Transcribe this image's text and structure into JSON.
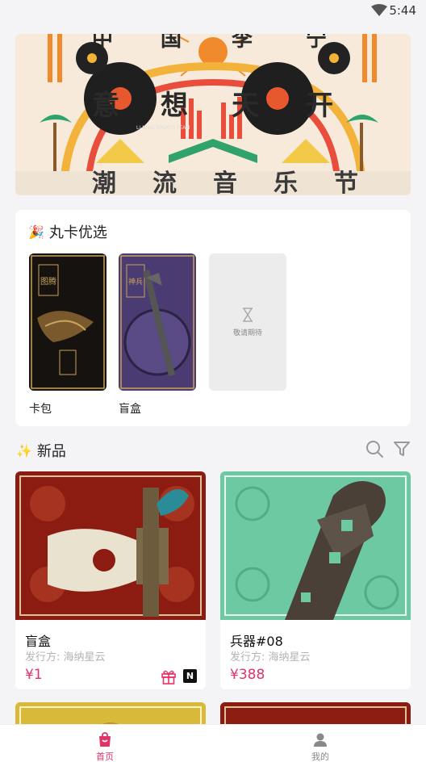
{
  "status_bar": {
    "time": "5:44"
  },
  "banner": {
    "top_text": [
      "中",
      "国",
      "李",
      "宁"
    ],
    "middle_text": [
      "意",
      "想",
      "天",
      "开"
    ],
    "bottom_text": [
      "潮",
      "流",
      "音",
      "乐",
      "节"
    ],
    "record_text": "LI-NING SPORTS TEAM"
  },
  "featured": {
    "title": "丸卡优选",
    "icon": "party-popper",
    "items": [
      {
        "label": "卡包",
        "art_tag": "图腾"
      },
      {
        "label": "盲盒",
        "art_tag": "神兵"
      }
    ],
    "placeholder_text": "敬请期待"
  },
  "new_section": {
    "title": "新品",
    "icon": "sparkles",
    "tools": [
      "search-icon",
      "filter-icon"
    ],
    "products": [
      {
        "name": "盲盒",
        "publisher": "发行方: 海纳星云",
        "price": "¥1",
        "badges": [
          "gift-icon",
          "n-badge"
        ],
        "badge_n": "N"
      },
      {
        "name": "兵器#08",
        "publisher": "发行方: 海纳星云",
        "price": "¥388"
      }
    ]
  },
  "tab_bar": {
    "tabs": [
      {
        "label": "首页",
        "active": true
      },
      {
        "label": "我的",
        "active": false
      }
    ]
  },
  "colors": {
    "accent": "#e33266",
    "price": "#e33266",
    "inactive_tab": "#888888"
  }
}
